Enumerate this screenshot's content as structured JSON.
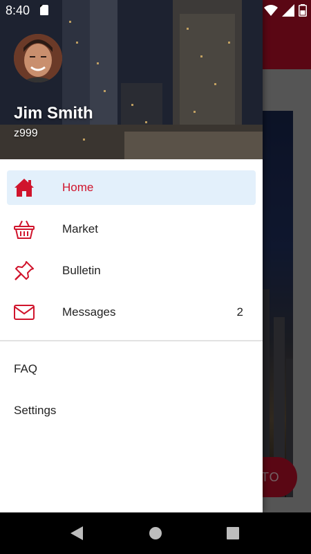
{
  "status_bar": {
    "time": "8:40"
  },
  "background": {
    "fab_label": "TO"
  },
  "drawer": {
    "user": {
      "name": "Jim Smith",
      "id": "z999"
    },
    "items": [
      {
        "label": "Home",
        "icon": "home-icon",
        "active": true
      },
      {
        "label": "Market",
        "icon": "basket-icon"
      },
      {
        "label": "Bulletin",
        "icon": "pushpin-icon"
      },
      {
        "label": "Messages",
        "icon": "mail-icon",
        "count": "2"
      }
    ],
    "secondary_items": [
      {
        "label": "FAQ"
      },
      {
        "label": "Settings"
      }
    ]
  },
  "colors": {
    "accent": "#d0142c",
    "active_bg": "#e3f0fb",
    "appbar": "#c8102e"
  }
}
